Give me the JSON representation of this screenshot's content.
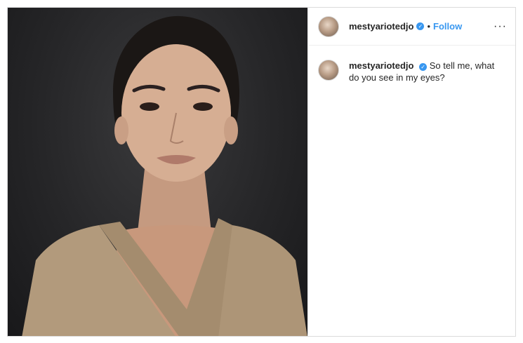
{
  "post": {
    "author": {
      "username": "mestyariotedjo",
      "verified_icon": "verified-badge-icon"
    },
    "header": {
      "separator": "•",
      "follow_label": "Follow",
      "more_label": "···"
    },
    "caption": {
      "username": "mestyariotedjo",
      "text": "So tell me, what do you see in my eyes?"
    },
    "colors": {
      "link": "#3897f0",
      "text": "#262626",
      "border": "#dbdbdb"
    }
  }
}
